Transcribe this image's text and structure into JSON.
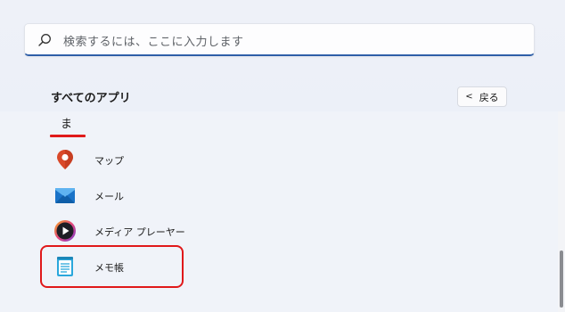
{
  "search": {
    "placeholder": "検索するには、ここに入力します",
    "icon": "search-icon"
  },
  "all_apps": {
    "title": "すべてのアプリ",
    "back_label": "戻る"
  },
  "section": {
    "letter": "ま",
    "underline_color": "#e01a1a"
  },
  "apps": [
    {
      "label": "マップ",
      "icon": "maps-icon"
    },
    {
      "label": "メール",
      "icon": "mail-icon"
    },
    {
      "label": "メディア プレーヤー",
      "icon": "media-player-icon"
    },
    {
      "label": "メモ帳",
      "icon": "notepad-icon"
    }
  ],
  "highlight_color": "#e0181a"
}
